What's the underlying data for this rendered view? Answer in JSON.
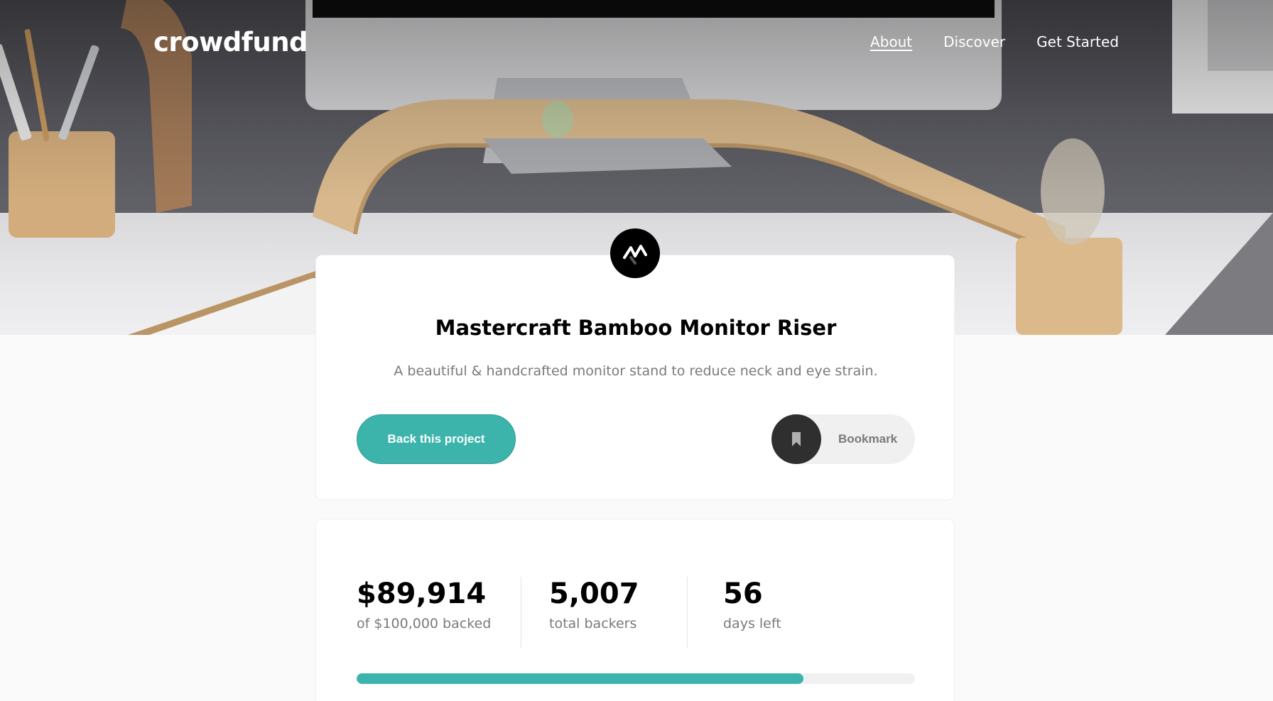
{
  "brand": {
    "logo_text": "crowdfund"
  },
  "nav": {
    "items": [
      {
        "label": "About",
        "active": true
      },
      {
        "label": "Discover",
        "active": false
      },
      {
        "label": "Get Started",
        "active": false
      }
    ]
  },
  "project": {
    "logo_icon": "mastercraft-logo-icon",
    "title": "Mastercraft Bamboo Monitor Riser",
    "subtitle": "A beautiful & handcrafted monitor stand to reduce neck and eye strain.",
    "back_button_label": "Back this project",
    "bookmark_label": "Bookmark",
    "bookmark_icon": "bookmark-icon"
  },
  "stats": {
    "backed_amount": "$89,914",
    "backed_label": "of $100,000 backed",
    "backers_count": "5,007",
    "backers_label": "total backers",
    "days_left": "56",
    "days_label": "days left",
    "progress_fraction": 0.8
  },
  "colors": {
    "accent": "#3cb4ac",
    "dark": "#2f2f2f",
    "muted_text": "#7a7a7a"
  }
}
